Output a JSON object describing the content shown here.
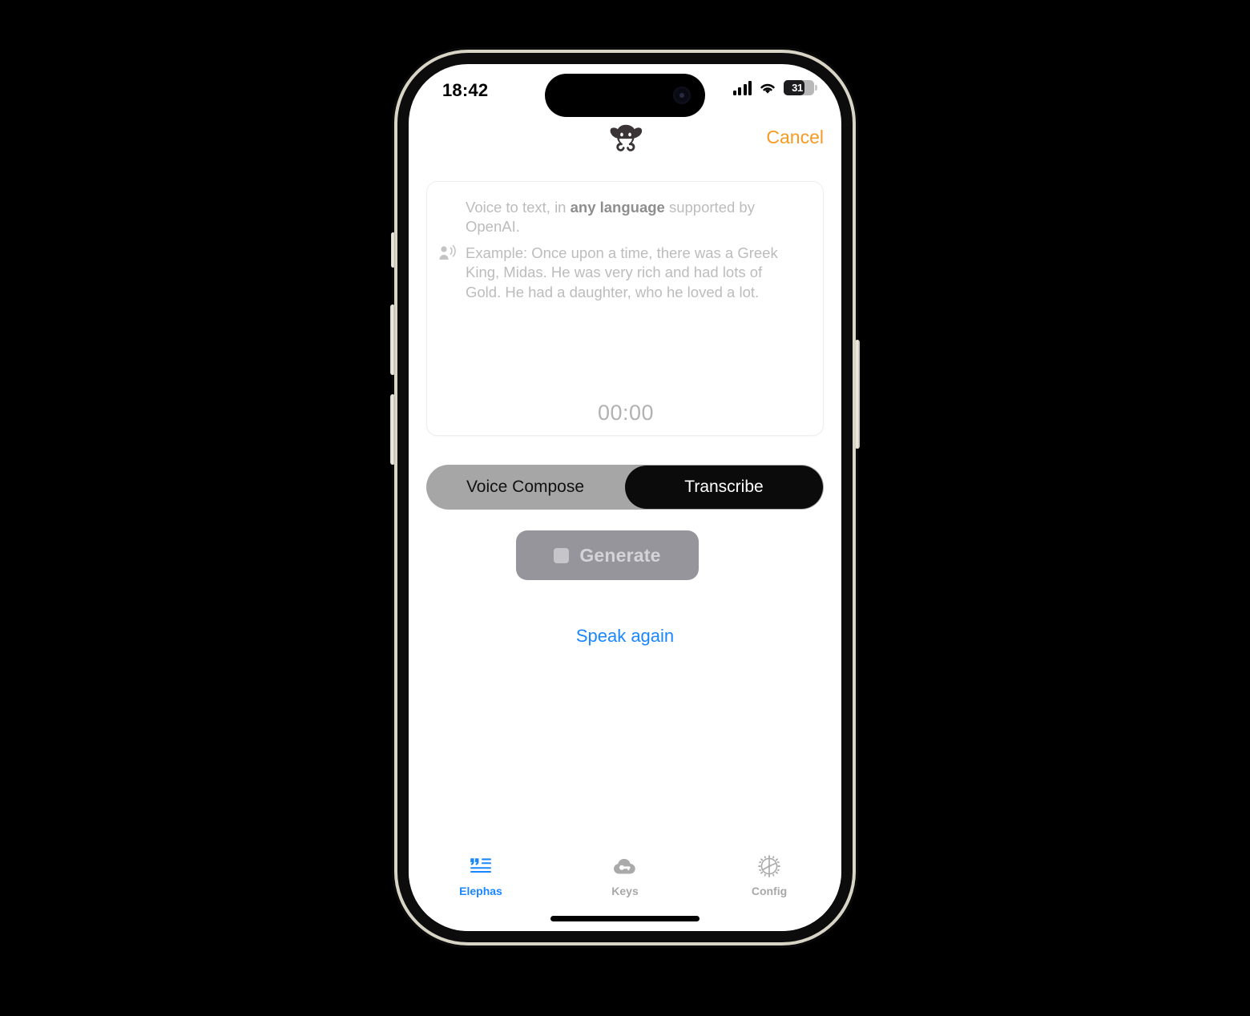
{
  "status_bar": {
    "time": "18:42",
    "battery_percent": "31",
    "cellular_icon": "cellular-signal-icon",
    "wifi_icon": "wifi-icon",
    "battery_icon": "battery-icon"
  },
  "header": {
    "logo_icon": "elephant-logo-icon",
    "cancel_label": "Cancel"
  },
  "transcript_card": {
    "placeholder_intro_prefix": "Voice to text, in ",
    "placeholder_intro_bold": "any language",
    "placeholder_intro_suffix": " supported by OpenAI.",
    "speaker_icon": "person-speaking-icon",
    "placeholder_example": "Example: Once upon a time, there was a Greek King, Midas. He was very rich and had lots of Gold. He had a daughter, who he loved a lot.",
    "timer": "00:00"
  },
  "mode_control": {
    "options": [
      {
        "label": "Voice Compose",
        "selected": false
      },
      {
        "label": "Transcribe",
        "selected": true
      }
    ]
  },
  "actions": {
    "generate_label": "Generate",
    "generate_icon": "stop-square-icon",
    "generate_enabled": false,
    "speak_again_label": "Speak again"
  },
  "tab_bar": {
    "items": [
      {
        "label": "Elephas",
        "icon": "text-quote-icon",
        "active": true
      },
      {
        "label": "Keys",
        "icon": "cloud-key-icon",
        "active": false
      },
      {
        "label": "Config",
        "icon": "gear-icon",
        "active": false
      }
    ]
  },
  "colors": {
    "accent_orange": "#f59a23",
    "accent_blue": "#1a86ff",
    "segment_track": "#a6a6a6",
    "segment_selected": "#0b0b0b",
    "disabled_button": "#95959b"
  }
}
